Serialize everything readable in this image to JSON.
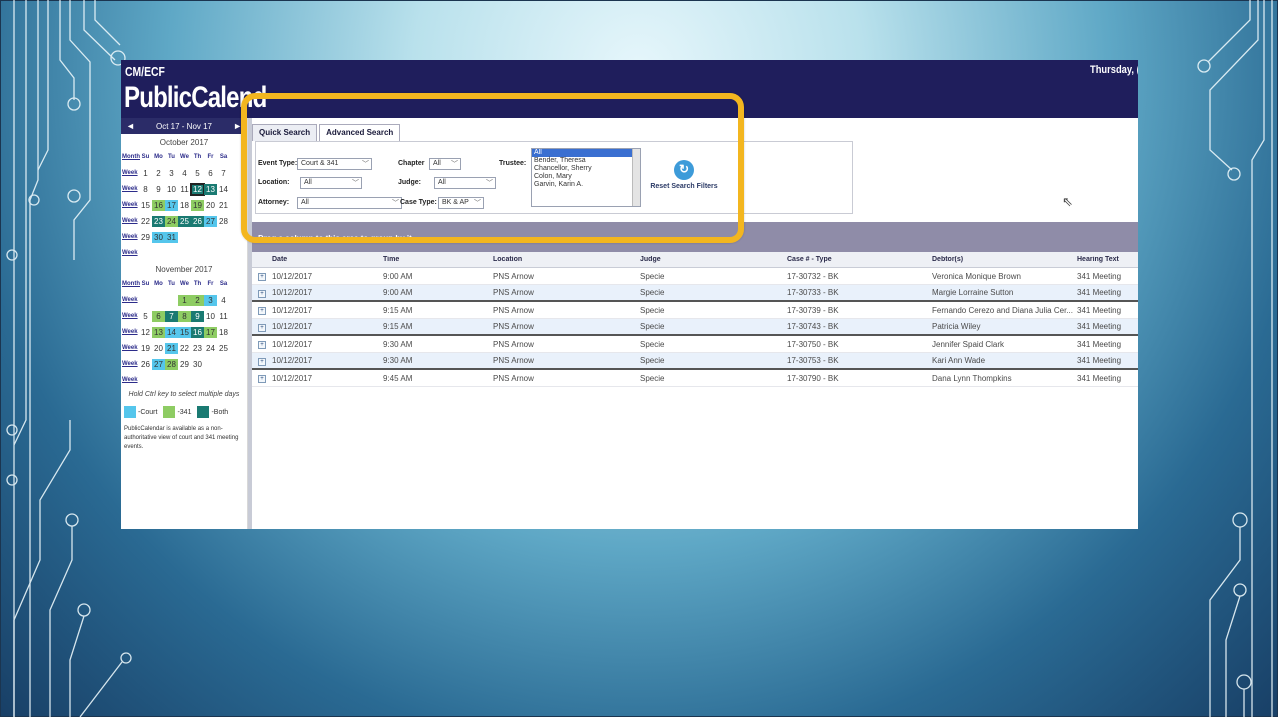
{
  "app": {
    "header_line1": "CM/ECF",
    "header_line2": "PublicCalend",
    "date_fragment": "Thursday, ("
  },
  "calendar": {
    "range": "Oct 17 - Nov 17",
    "prev_arrow": "◄",
    "next_arrow": "►",
    "day_headers": [
      "Su",
      "Mo",
      "Tu",
      "We",
      "Th",
      "Fr",
      "Sa"
    ],
    "month_label": "Month",
    "week_label": "Week",
    "months": [
      {
        "title": "October 2017",
        "weeks": [
          [
            {
              "d": "1"
            },
            {
              "d": "2"
            },
            {
              "d": "3"
            },
            {
              "d": "4"
            },
            {
              "d": "5"
            },
            {
              "d": "6"
            },
            {
              "d": "7"
            }
          ],
          [
            {
              "d": "8"
            },
            {
              "d": "9"
            },
            {
              "d": "10"
            },
            {
              "d": "11"
            },
            {
              "d": "12",
              "t": "both",
              "today": true
            },
            {
              "d": "13",
              "t": "both"
            },
            {
              "d": "14"
            }
          ],
          [
            {
              "d": "15"
            },
            {
              "d": "16",
              "t": "meet"
            },
            {
              "d": "17",
              "t": "court"
            },
            {
              "d": "18"
            },
            {
              "d": "19",
              "t": "meet"
            },
            {
              "d": "20"
            },
            {
              "d": "21"
            }
          ],
          [
            {
              "d": "22"
            },
            {
              "d": "23",
              "t": "both"
            },
            {
              "d": "24",
              "t": "meet"
            },
            {
              "d": "25",
              "t": "both"
            },
            {
              "d": "26",
              "t": "both"
            },
            {
              "d": "27",
              "t": "court"
            },
            {
              "d": "28"
            }
          ],
          [
            {
              "d": "29"
            },
            {
              "d": "30",
              "t": "court"
            },
            {
              "d": "31",
              "t": "court"
            },
            {
              "d": ""
            },
            {
              "d": ""
            },
            {
              "d": ""
            },
            {
              "d": ""
            }
          ],
          [
            {
              "d": ""
            },
            {
              "d": ""
            },
            {
              "d": ""
            },
            {
              "d": ""
            },
            {
              "d": ""
            },
            {
              "d": ""
            },
            {
              "d": ""
            }
          ]
        ]
      },
      {
        "title": "November 2017",
        "weeks": [
          [
            {
              "d": ""
            },
            {
              "d": ""
            },
            {
              "d": ""
            },
            {
              "d": "1",
              "t": "meet"
            },
            {
              "d": "2",
              "t": "meet"
            },
            {
              "d": "3",
              "t": "court"
            },
            {
              "d": "4"
            }
          ],
          [
            {
              "d": "5"
            },
            {
              "d": "6",
              "t": "meet"
            },
            {
              "d": "7",
              "t": "both"
            },
            {
              "d": "8",
              "t": "meet"
            },
            {
              "d": "9",
              "t": "both"
            },
            {
              "d": "10"
            },
            {
              "d": "11"
            }
          ],
          [
            {
              "d": "12"
            },
            {
              "d": "13",
              "t": "meet"
            },
            {
              "d": "14",
              "t": "court"
            },
            {
              "d": "15",
              "t": "court"
            },
            {
              "d": "16",
              "t": "both"
            },
            {
              "d": "17",
              "t": "meet"
            },
            {
              "d": "18"
            }
          ],
          [
            {
              "d": "19"
            },
            {
              "d": "20"
            },
            {
              "d": "21",
              "t": "court"
            },
            {
              "d": "22"
            },
            {
              "d": "23"
            },
            {
              "d": "24"
            },
            {
              "d": "25"
            }
          ],
          [
            {
              "d": "26"
            },
            {
              "d": "27",
              "t": "court"
            },
            {
              "d": "28",
              "t": "meet"
            },
            {
              "d": "29"
            },
            {
              "d": "30"
            },
            {
              "d": ""
            },
            {
              "d": ""
            }
          ],
          [
            {
              "d": ""
            },
            {
              "d": ""
            },
            {
              "d": ""
            },
            {
              "d": ""
            },
            {
              "d": ""
            },
            {
              "d": ""
            },
            {
              "d": ""
            }
          ]
        ]
      }
    ],
    "hint": "Hold Ctrl key to select multiple days",
    "legend": [
      {
        "label": "-Court",
        "color": "#55c6ec"
      },
      {
        "label": "-341",
        "color": "#8ecc63"
      },
      {
        "label": "-Both",
        "color": "#1a7a72"
      }
    ],
    "note": "PublicCalendar is available as a non-authoritative view of court and 341 meeting events."
  },
  "tabs": [
    "Quick Search",
    "Advanced Search"
  ],
  "filters": {
    "event_type_label": "Event Type:",
    "event_type_value": "Court & 341",
    "location_label": "Location:",
    "location_value": "All",
    "attorney_label": "Attorney:",
    "attorney_value": "All",
    "chapter_label": "Chapter",
    "chapter_value": "All",
    "judge_label": "Judge:",
    "judge_value": "All",
    "case_type_label": "Case Type:",
    "case_type_value": "BK & AP",
    "trustee_label": "Trustee:",
    "trustee_options": [
      "All",
      "Bender, Theresa",
      "Chancellor, Sherry",
      "Colon, Mary",
      "Garvin, Karin A."
    ],
    "dropdown_glyph": "﹀",
    "reset_label": "Reset Search Filters",
    "reset_icon": "↻"
  },
  "group_bar": "Drag a column to this area to group by it",
  "grid": {
    "headers": [
      "Date",
      "Time",
      "Location",
      "Judge",
      "Case # - Type",
      "Debtor(s)",
      "Hearing Text"
    ],
    "expander": "+",
    "rows": [
      [
        "10/12/2017",
        "9:00 AM",
        "PNS Arnow",
        "Specie",
        "17-30732 - BK",
        "Veronica Monique Brown",
        "341 Meeting"
      ],
      [
        "10/12/2017",
        "9:00 AM",
        "PNS Arnow",
        "Specie",
        "17-30733 - BK",
        "Margie Lorraine Sutton",
        "341 Meeting"
      ],
      [
        "10/12/2017",
        "9:15 AM",
        "PNS Arnow",
        "Specie",
        "17-30739 - BK",
        "Fernando Cerezo and Diana Julia Cer...",
        "341 Meeting"
      ],
      [
        "10/12/2017",
        "9:15 AM",
        "PNS Arnow",
        "Specie",
        "17-30743 - BK",
        "Patricia Wiley",
        "341 Meeting"
      ],
      [
        "10/12/2017",
        "9:30 AM",
        "PNS Arnow",
        "Specie",
        "17-30750 - BK",
        "Jennifer Spaid Clark",
        "341 Meeting"
      ],
      [
        "10/12/2017",
        "9:30 AM",
        "PNS Arnow",
        "Specie",
        "17-30753 - BK",
        "Kari Ann Wade",
        "341 Meeting"
      ],
      [
        "10/12/2017",
        "9:45 AM",
        "PNS Arnow",
        "Specie",
        "17-30790 - BK",
        "Dana Lynn Thompkins",
        "341 Meeting"
      ]
    ]
  },
  "colors": {
    "header_bg": "#1f1e5c",
    "highlight": "#f3b61f",
    "court": "#55c6ec",
    "meeting_341": "#8ecc63",
    "both": "#1a7a72"
  }
}
